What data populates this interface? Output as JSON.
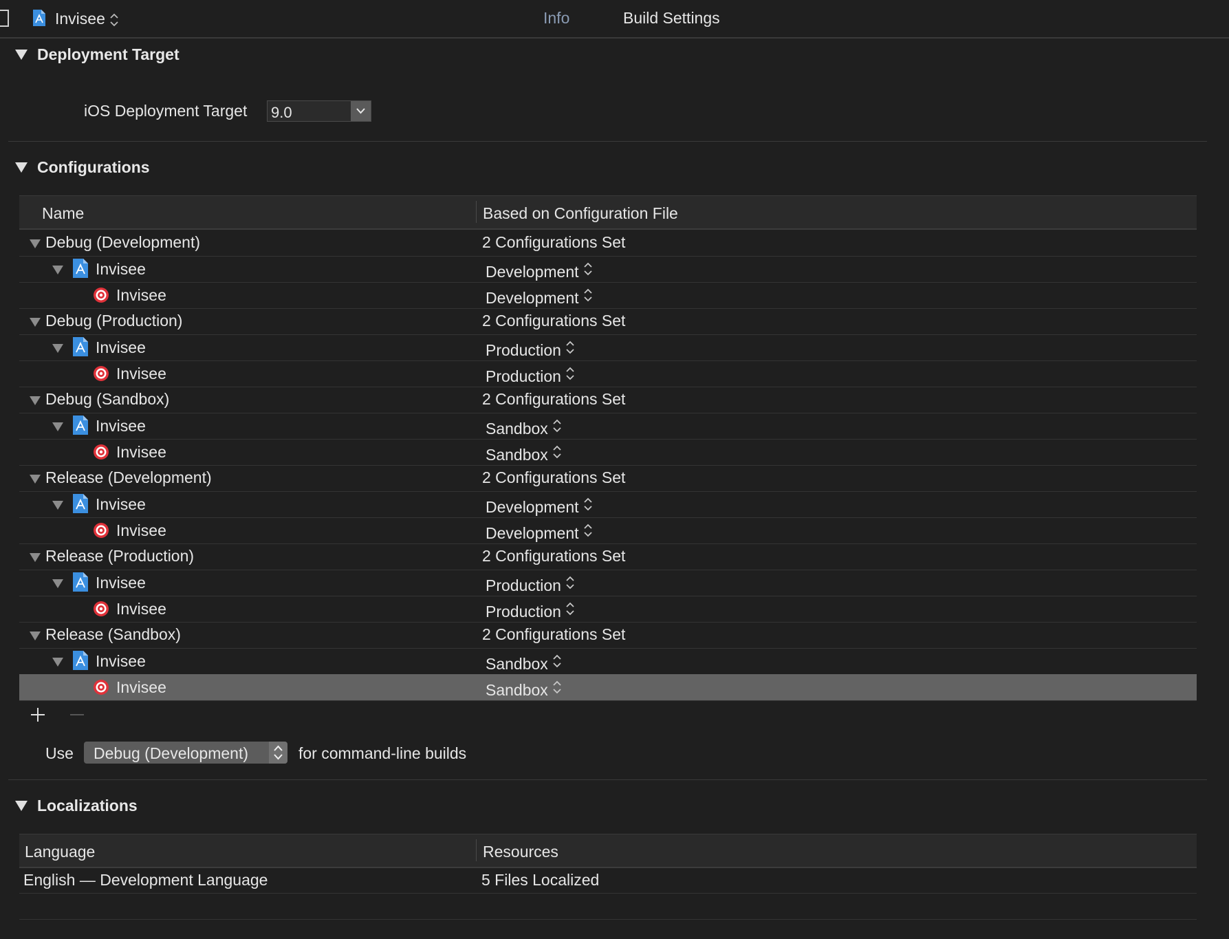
{
  "header": {
    "project_name": "Invisee",
    "tabs": [
      {
        "label": "Info",
        "active": true
      },
      {
        "label": "Build Settings",
        "active": false
      }
    ]
  },
  "deployment": {
    "section_title": "Deployment Target",
    "ios_label": "iOS Deployment Target",
    "ios_value": "9.0"
  },
  "configurations": {
    "section_title": "Configurations",
    "col_name": "Name",
    "col_file": "Based on Configuration File",
    "groups": [
      {
        "name": "Debug (Development)",
        "summary": "2 Configurations Set",
        "project": "Invisee",
        "project_file": "Development",
        "target": "Invisee",
        "target_file": "Development"
      },
      {
        "name": "Debug (Production)",
        "summary": "2 Configurations Set",
        "project": "Invisee",
        "project_file": "Production",
        "target": "Invisee",
        "target_file": "Production"
      },
      {
        "name": "Debug (Sandbox)",
        "summary": "2 Configurations Set",
        "project": "Invisee",
        "project_file": "Sandbox",
        "target": "Invisee",
        "target_file": "Sandbox"
      },
      {
        "name": "Release (Development)",
        "summary": "2 Configurations Set",
        "project": "Invisee",
        "project_file": "Development",
        "target": "Invisee",
        "target_file": "Development"
      },
      {
        "name": "Release (Production)",
        "summary": "2 Configurations Set",
        "project": "Invisee",
        "project_file": "Production",
        "target": "Invisee",
        "target_file": "Production"
      },
      {
        "name": "Release (Sandbox)",
        "summary": "2 Configurations Set",
        "project": "Invisee",
        "project_file": "Sandbox",
        "target": "Invisee",
        "target_file": "Sandbox"
      }
    ],
    "use_label": "Use",
    "use_value": "Debug (Development)",
    "use_suffix": "for command-line builds"
  },
  "localizations": {
    "section_title": "Localizations",
    "col_language": "Language",
    "col_resources": "Resources",
    "rows": [
      {
        "language": "English — Development Language",
        "resources": "5 Files Localized"
      }
    ]
  },
  "colors": {
    "background": "#1f1f1f",
    "selected_row": "#636363",
    "active_tab": "#8a9bb3",
    "file_icon": "#3b8fe0",
    "target_icon": "#e0323a"
  }
}
